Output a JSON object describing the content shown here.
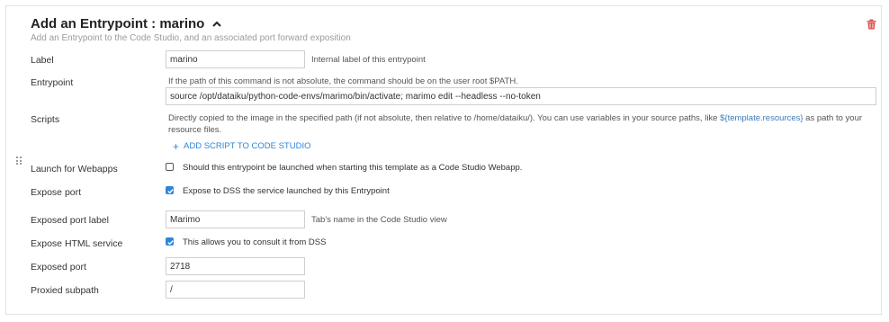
{
  "header": {
    "title": "Add an Entrypoint : marino",
    "subtitle": "Add an Entrypoint to the Code Studio, and an associated port forward exposition"
  },
  "fields": {
    "label": {
      "label": "Label",
      "value": "marino",
      "hint": "Internal label of this entrypoint"
    },
    "entrypoint": {
      "label": "Entrypoint",
      "description": "If the path of this command is not absolute, the command should be on the user root $PATH.",
      "value": "source /opt/dataiku/python-code-envs/marimo/bin/activate; marimo edit --headless --no-token"
    },
    "scripts": {
      "label": "Scripts",
      "description_before": "Directly copied to the image in the specified path (if not absolute, then relative to /home/dataiku/). You can use variables in your source paths, like ",
      "description_code": "${template.resources}",
      "description_after": " as path to your resource files.",
      "add_link": "ADD SCRIPT TO CODE STUDIO"
    },
    "launch_webapps": {
      "label": "Launch for Webapps",
      "checked": false,
      "text": "Should this entrypoint be launched when starting this template as a Code Studio Webapp."
    },
    "expose_port": {
      "label": "Expose port",
      "checked": true,
      "text": "Expose to DSS the service launched by this Entrypoint"
    },
    "exposed_port_label": {
      "label": "Exposed port label",
      "value": "Marimo",
      "hint": "Tab's name in the Code Studio view"
    },
    "expose_html": {
      "label": "Expose HTML service",
      "checked": true,
      "text": "This allows you to consult it from DSS"
    },
    "exposed_port": {
      "label": "Exposed port",
      "value": "2718"
    },
    "proxied_subpath": {
      "label": "Proxied subpath",
      "value": "/"
    }
  },
  "icons": {
    "collapse": "chevron-up-icon",
    "delete": "trash-icon",
    "drag": "drag-handle-icon",
    "add": "plus-icon"
  },
  "colors": {
    "accent": "#2d86d9",
    "delete": "#d9534f",
    "border": "#e3e3e3"
  }
}
